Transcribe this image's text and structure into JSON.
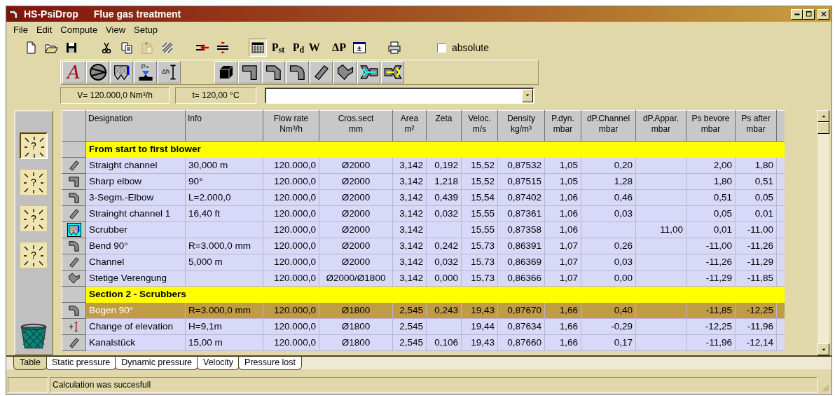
{
  "window": {
    "app_name": "HS-PsiDrop",
    "title": "Flue gas treatment"
  },
  "menu": [
    "File",
    "Edit",
    "Compute",
    "View",
    "Setup"
  ],
  "toolbar": [
    [
      {
        "kind": "new",
        "selected": false,
        "disabled": false
      },
      {
        "kind": "open",
        "selected": false,
        "disabled": false
      },
      {
        "kind": "save",
        "selected": false,
        "disabled": false
      }
    ],
    [
      {
        "kind": "cut",
        "selected": false,
        "disabled": false
      },
      {
        "kind": "copy",
        "selected": false,
        "disabled": false
      },
      {
        "kind": "paste",
        "selected": false,
        "disabled": true
      },
      {
        "kind": "hatch",
        "selected": false,
        "disabled": false
      }
    ],
    [
      {
        "kind": "insert",
        "selected": false,
        "disabled": false
      },
      {
        "kind": "distribute",
        "selected": false,
        "disabled": false
      }
    ],
    [
      {
        "kind": "table",
        "selected": true,
        "disabled": false
      },
      {
        "kind": "text",
        "label": "P$_{st}$",
        "selected": false,
        "disabled": false
      },
      {
        "kind": "text",
        "label": "P$_{d}$",
        "selected": false,
        "disabled": false
      },
      {
        "kind": "text",
        "label": "W⃗",
        "selected": false,
        "disabled": false
      },
      {
        "kind": "text",
        "label": "ΔP",
        "selected": false,
        "disabled": false
      },
      {
        "kind": "window",
        "label": "±",
        "selected": false,
        "disabled": false
      }
    ],
    [
      {
        "kind": "print",
        "selected": false,
        "disabled": false
      }
    ]
  ],
  "absolute_checkbox": {
    "label": "absolute",
    "checked": false
  },
  "palette": [
    [
      {
        "kind": "script",
        "label": "A"
      },
      {
        "kind": "fan"
      },
      {
        "kind": "scrubber"
      },
      {
        "kind": "pressure",
        "label": "P="
      },
      {
        "kind": "elevation",
        "label": "Δh"
      }
    ],
    [
      {
        "kind": "block"
      },
      {
        "kind": "sharp-elbow"
      },
      {
        "kind": "segm-elbow"
      },
      {
        "kind": "bend"
      },
      {
        "kind": "channel"
      },
      {
        "kind": "reducer"
      },
      {
        "kind": "branch-cyan"
      },
      {
        "kind": "branch-yellow"
      }
    ]
  ],
  "info": {
    "flow": "V= 120.000,0 Nm³/h",
    "temperature": "t= 120,00 °C"
  },
  "slots": [
    {
      "label": "?",
      "selected": true
    },
    {
      "label": "?",
      "selected": false
    },
    {
      "label": "?",
      "selected": false
    },
    {
      "label": "?",
      "selected": false
    }
  ],
  "table": {
    "columns": [
      {
        "label": "Designation"
      },
      {
        "label": "Info"
      },
      {
        "label": "Flow rate",
        "unit": "Nm³/h"
      },
      {
        "label": "Cros.sect",
        "unit": "mm"
      },
      {
        "label": "Area",
        "unit": "m²"
      },
      {
        "label": "Zeta"
      },
      {
        "label": "Veloc.",
        "unit": "m/s"
      },
      {
        "label": "Density",
        "unit": "kg/m³"
      },
      {
        "label": "P.dyn.",
        "unit": "mbar"
      },
      {
        "label": "dP.Channel",
        "unit": "mbar"
      },
      {
        "label": "dP.Appar.",
        "unit": "mbar"
      },
      {
        "label": "Ps bevore",
        "unit": "mbar"
      },
      {
        "label": "Ps after",
        "unit": "mbar"
      }
    ],
    "rows": [
      {
        "kind": "section",
        "title": "From start to first blower",
        "selected": false
      },
      {
        "kind": "channel",
        "selected": false,
        "cells": [
          "Straight channel",
          "30,000 m",
          "120.000,0",
          "Ø2000",
          "3,142",
          "0,192",
          "15,52",
          "0,87532",
          "1,05",
          "0,20",
          null,
          "2,00",
          "1,80"
        ]
      },
      {
        "kind": "sharp-elbow",
        "selected": false,
        "cells": [
          "Sharp elbow",
          "90°",
          "120.000,0",
          "Ø2000",
          "3,142",
          "1,218",
          "15,52",
          "0,87515",
          "1,05",
          "1,28",
          null,
          "1,80",
          "0,51"
        ]
      },
      {
        "kind": "segm-elbow",
        "selected": false,
        "cells": [
          "3-Segm.-Elbow",
          "L=2.000,0",
          "120.000,0",
          "Ø2000",
          "3,142",
          "0,439",
          "15,54",
          "0,87402",
          "1,06",
          "0,46",
          null,
          "0,51",
          "0,05"
        ]
      },
      {
        "kind": "channel",
        "selected": false,
        "cells": [
          "Strainght channel 1",
          "16,40 ft",
          "120.000,0",
          "Ø2000",
          "3,142",
          "0,032",
          "15,55",
          "0,87361",
          "1,06",
          "0,03",
          null,
          "0,05",
          "0,01"
        ]
      },
      {
        "kind": "scrubber",
        "selected": false,
        "cells": [
          "Scrubber",
          null,
          "120.000,0",
          "Ø2000",
          "3,142",
          null,
          "15,55",
          "0,87358",
          "1,06",
          null,
          "11,00",
          "0,01",
          "-11,00"
        ]
      },
      {
        "kind": "bend",
        "selected": false,
        "cells": [
          "Bend 90°",
          "R=3.000,0 mm",
          "120.000,0",
          "Ø2000",
          "3,142",
          "0,242",
          "15,73",
          "0,86391",
          "1,07",
          "0,26",
          null,
          "-11,00",
          "-11,26"
        ]
      },
      {
        "kind": "channel",
        "selected": false,
        "cells": [
          "Channel",
          "5,000 m",
          "120.000,0",
          "Ø2000",
          "3,142",
          "0,032",
          "15,73",
          "0,86369",
          "1,07",
          "0,03",
          null,
          "-11,26",
          "-11,29"
        ]
      },
      {
        "kind": "reducer",
        "selected": false,
        "cells": [
          "Stetige Verengung",
          null,
          "120.000,0",
          "Ø2000/Ø1800",
          "3,142",
          "0,000",
          "15,73",
          "0,86366",
          "1,07",
          "0,00",
          null,
          "-11,29",
          "-11,85"
        ]
      },
      {
        "kind": "section",
        "title": "Section 2 - Scrubbers",
        "selected": false
      },
      {
        "kind": "bend",
        "selected": true,
        "cells": [
          "Bogen 90°",
          "R=3.000,0 mm",
          "120.000,0",
          "Ø1800",
          "2,545",
          "0,243",
          "19,43",
          "0,87670",
          "1,66",
          "0,40",
          null,
          "-11,85",
          "-12,25"
        ]
      },
      {
        "kind": "elevation",
        "selected": false,
        "cells": [
          "Change of elevation",
          "H=9,1m",
          "120.000,0",
          "Ø1800",
          "2,545",
          null,
          "19,44",
          "0,87634",
          "1,66",
          "-0,29",
          null,
          "-12,25",
          "-11,96"
        ]
      },
      {
        "kind": "channel",
        "selected": false,
        "cells": [
          "Kanalstück",
          "15,00 m",
          "120.000,0",
          "Ø1800",
          "2,545",
          "0,106",
          "19,43",
          "0,87660",
          "1,66",
          "0,17",
          null,
          "-11,96",
          "-12,14"
        ]
      }
    ]
  },
  "tabs": [
    {
      "label": "Table",
      "selected": true
    },
    {
      "label": "Static pressure",
      "selected": false
    },
    {
      "label": "Dynamic pressure",
      "selected": false
    },
    {
      "label": "Velocity",
      "selected": false
    },
    {
      "label": "Pressure lost",
      "selected": false
    }
  ],
  "status_bar": {
    "message": "Calculation was succesfull"
  }
}
